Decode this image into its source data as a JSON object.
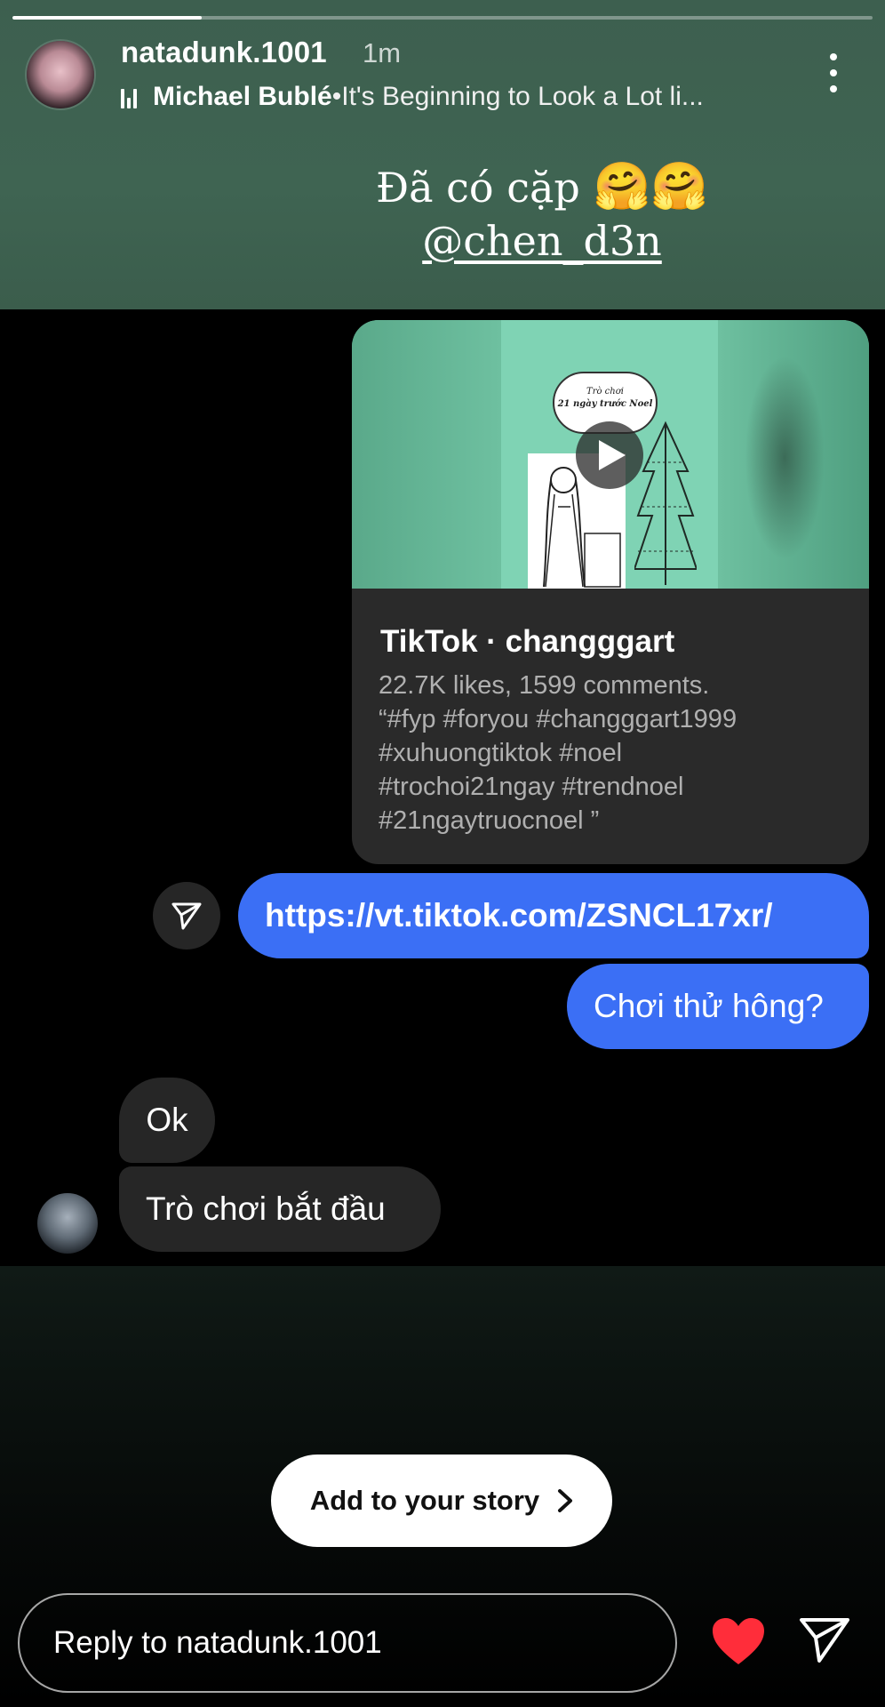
{
  "story": {
    "progress": 0.22,
    "username": "natadunk.1001",
    "time": "1m",
    "music": {
      "artist": "Michael Bublé",
      "separator": " • ",
      "song": "It's Beginning to Look a Lot li..."
    },
    "caption": {
      "line1": "Đã có cặp",
      "emoji": "🤗🤗",
      "mention": "@chen_d3n"
    }
  },
  "chat": {
    "tiktok_card": {
      "thumb_text_1": "Trò chơi",
      "thumb_text_2": "21 ngày trước Noel",
      "title": "TikTok · changggart",
      "description": "22.7K likes, 1599 comments.\n“#fyp #foryou #changggart1999\n#xuhuongtiktok #noel\n#trochoi21ngay #trendnoel\n#21ngaytruocnoel ”"
    },
    "link_message": "https://vt.tiktok.com/ZSNCL17xr/",
    "question_message": "Chơi thử hông?",
    "reply_ok": "Ok",
    "reply_start": "Trò chơi bắt đầu"
  },
  "bottom": {
    "add_to_story": "Add to your story",
    "reply_placeholder": "Reply to natadunk.1001"
  },
  "colors": {
    "story_bg": "#3f6452",
    "bubble_blue": "#3b6ff5",
    "bubble_gray": "#262626",
    "heart": "#ff2d3a"
  },
  "icons": [
    "music-bars-icon",
    "more-vertical-icon",
    "play-icon",
    "send-icon",
    "chevron-right-icon",
    "heart-icon"
  ]
}
